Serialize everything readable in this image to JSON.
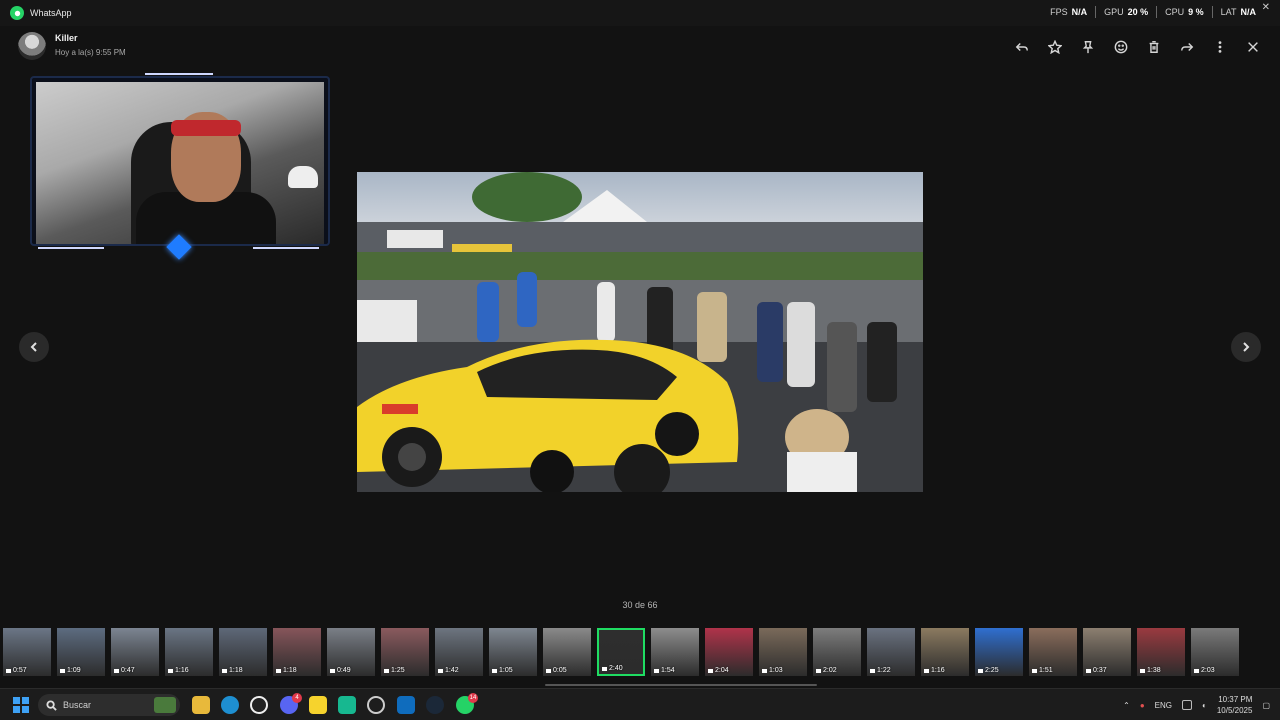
{
  "window": {
    "app_name": "WhatsApp"
  },
  "perf": [
    {
      "key": "FPS",
      "value": "N/A"
    },
    {
      "key": "GPU",
      "value": "20 %"
    },
    {
      "key": "CPU",
      "value": "9 %"
    },
    {
      "key": "LAT",
      "value": "N/A"
    }
  ],
  "header": {
    "sender": "Killer",
    "timestamp": "Hoy a la(s) 9:55 PM"
  },
  "actions": [
    "reply-icon",
    "star-icon",
    "pin-icon",
    "emoji-icon",
    "delete-icon",
    "forward-icon",
    "more-icon",
    "close-icon"
  ],
  "viewer": {
    "counter": "30 de 66"
  },
  "thumbnails": [
    {
      "dur": "0:57",
      "color": "#6b7686"
    },
    {
      "dur": "1:09",
      "color": "#5d6c80"
    },
    {
      "dur": "0:47",
      "color": "#7c8592"
    },
    {
      "dur": "1:16",
      "color": "#6a7584"
    },
    {
      "dur": "1:18",
      "color": "#5e6878"
    },
    {
      "dur": "1:18",
      "color": "#86555a"
    },
    {
      "dur": "0:49",
      "color": "#7a7f87"
    },
    {
      "dur": "1:25",
      "color": "#8a5a5e"
    },
    {
      "dur": "1:42",
      "color": "#6d7580"
    },
    {
      "dur": "1:05",
      "color": "#7e8690"
    },
    {
      "dur": "0:05",
      "color": "#8a8a8a"
    },
    {
      "dur": "2:40",
      "color": "#2e2e2e",
      "active": true
    },
    {
      "dur": "1:54",
      "color": "#8d8d8d"
    },
    {
      "dur": "2:04",
      "color": "#b0334a"
    },
    {
      "dur": "1:03",
      "color": "#7a6a5a"
    },
    {
      "dur": "2:02",
      "color": "#7d7d7d"
    },
    {
      "dur": "1:22",
      "color": "#6a7280"
    },
    {
      "dur": "1:16",
      "color": "#8b7a60"
    },
    {
      "dur": "2:25",
      "color": "#2f6fd0"
    },
    {
      "dur": "1:51",
      "color": "#8a6d5c"
    },
    {
      "dur": "0:37",
      "color": "#8c7f70"
    },
    {
      "dur": "1:38",
      "color": "#9a3a40"
    },
    {
      "dur": "2:03",
      "color": "#7a7a7a"
    }
  ],
  "taskbar": {
    "search_placeholder": "Buscar",
    "whatsapp_badge": "14",
    "discord_badge": "4",
    "lang": "ENG",
    "time": "10:37 PM",
    "date": "10/5/2025"
  },
  "colors": {
    "accent": "#1fdc62",
    "background": "#121212"
  }
}
